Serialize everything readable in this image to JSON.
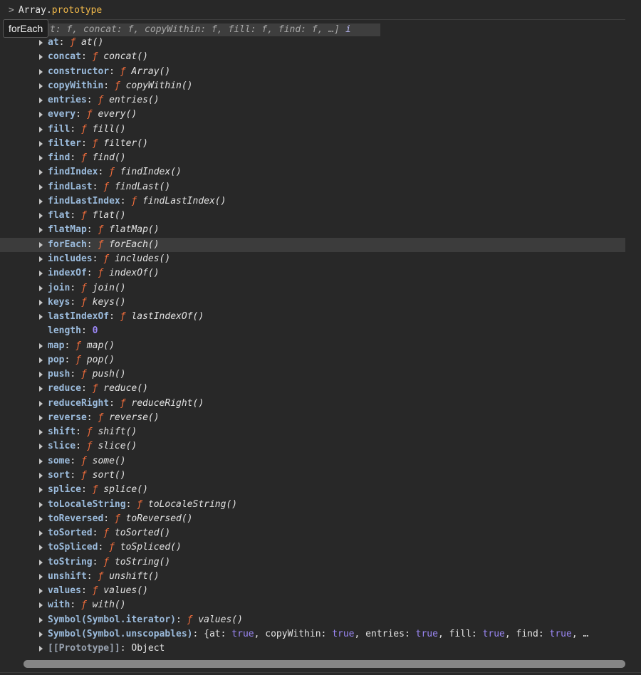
{
  "console": {
    "expression_object": "Array",
    "expression_dot": ".",
    "expression_property": "prototype",
    "preview_text": "t: f, concat: f, copyWithin: f, fill: f, find: f, …]",
    "preview_info": "i",
    "tooltip": "forEach",
    "function_symbol": "ƒ"
  },
  "properties": [
    {
      "key": "at",
      "sig": "at()"
    },
    {
      "key": "concat",
      "sig": "concat()"
    },
    {
      "key": "constructor",
      "sig": "Array()"
    },
    {
      "key": "copyWithin",
      "sig": "copyWithin()"
    },
    {
      "key": "entries",
      "sig": "entries()"
    },
    {
      "key": "every",
      "sig": "every()"
    },
    {
      "key": "fill",
      "sig": "fill()"
    },
    {
      "key": "filter",
      "sig": "filter()"
    },
    {
      "key": "find",
      "sig": "find()"
    },
    {
      "key": "findIndex",
      "sig": "findIndex()"
    },
    {
      "key": "findLast",
      "sig": "findLast()"
    },
    {
      "key": "findLastIndex",
      "sig": "findLastIndex()"
    },
    {
      "key": "flat",
      "sig": "flat()"
    },
    {
      "key": "flatMap",
      "sig": "flatMap()"
    },
    {
      "key": "forEach",
      "sig": "forEach()",
      "highlighted": true
    },
    {
      "key": "includes",
      "sig": "includes()"
    },
    {
      "key": "indexOf",
      "sig": "indexOf()"
    },
    {
      "key": "join",
      "sig": "join()"
    },
    {
      "key": "keys",
      "sig": "keys()"
    },
    {
      "key": "lastIndexOf",
      "sig": "lastIndexOf()"
    },
    {
      "key": "length",
      "value": "0",
      "kind": "number"
    },
    {
      "key": "map",
      "sig": "map()"
    },
    {
      "key": "pop",
      "sig": "pop()"
    },
    {
      "key": "push",
      "sig": "push()"
    },
    {
      "key": "reduce",
      "sig": "reduce()"
    },
    {
      "key": "reduceRight",
      "sig": "reduceRight()"
    },
    {
      "key": "reverse",
      "sig": "reverse()"
    },
    {
      "key": "shift",
      "sig": "shift()"
    },
    {
      "key": "slice",
      "sig": "slice()"
    },
    {
      "key": "some",
      "sig": "some()"
    },
    {
      "key": "sort",
      "sig": "sort()"
    },
    {
      "key": "splice",
      "sig": "splice()"
    },
    {
      "key": "toLocaleString",
      "sig": "toLocaleString()"
    },
    {
      "key": "toReversed",
      "sig": "toReversed()"
    },
    {
      "key": "toSorted",
      "sig": "toSorted()"
    },
    {
      "key": "toSpliced",
      "sig": "toSpliced()"
    },
    {
      "key": "toString",
      "sig": "toString()"
    },
    {
      "key": "unshift",
      "sig": "unshift()"
    },
    {
      "key": "values",
      "sig": "values()"
    },
    {
      "key": "with",
      "sig": "with()"
    },
    {
      "key": "Symbol(Symbol.iterator)",
      "sig": "values()"
    },
    {
      "key": "Symbol(Symbol.unscopables)",
      "kind": "object",
      "parts": [
        {
          "t": "{",
          "c": "plain"
        },
        {
          "t": "at",
          "c": "plain"
        },
        {
          "t": ": ",
          "c": "plain"
        },
        {
          "t": "true",
          "c": "kw"
        },
        {
          "t": ", ",
          "c": "plain"
        },
        {
          "t": "copyWithin",
          "c": "plain"
        },
        {
          "t": ": ",
          "c": "plain"
        },
        {
          "t": "true",
          "c": "kw"
        },
        {
          "t": ", ",
          "c": "plain"
        },
        {
          "t": "entries",
          "c": "plain"
        },
        {
          "t": ": ",
          "c": "plain"
        },
        {
          "t": "true",
          "c": "kw"
        },
        {
          "t": ", ",
          "c": "plain"
        },
        {
          "t": "fill",
          "c": "plain"
        },
        {
          "t": ": ",
          "c": "plain"
        },
        {
          "t": "true",
          "c": "kw"
        },
        {
          "t": ", ",
          "c": "plain"
        },
        {
          "t": "find",
          "c": "plain"
        },
        {
          "t": ": ",
          "c": "plain"
        },
        {
          "t": "true",
          "c": "kw"
        },
        {
          "t": ", …",
          "c": "plain"
        }
      ]
    },
    {
      "key": "[[Prototype]]",
      "value": "Object",
      "kind": "internal"
    }
  ]
}
